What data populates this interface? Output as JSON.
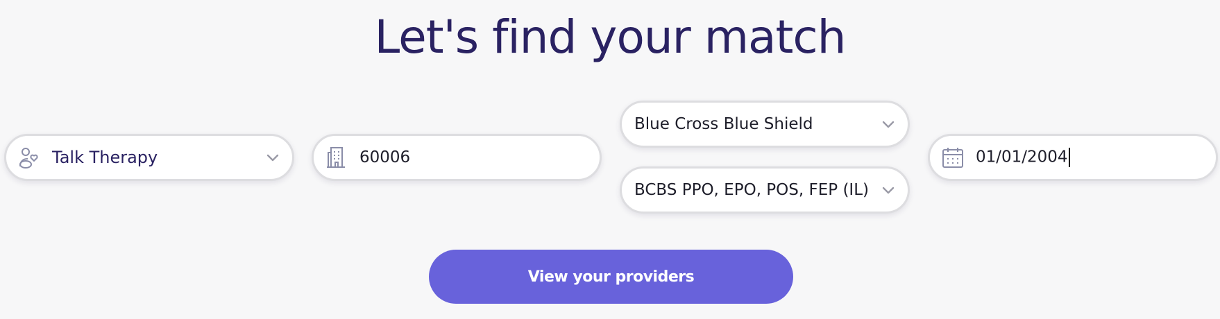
{
  "page": {
    "title": "Let's find your match"
  },
  "colors": {
    "background": "#f7f7f8",
    "title": "#2a2262",
    "accent": "#6862db",
    "field_border": "#dddde0",
    "icon": "#8a8da8"
  },
  "form": {
    "care_type": {
      "value": "Talk Therapy",
      "icon": "people-heart-icon"
    },
    "zip": {
      "value": "60006",
      "icon": "building-icon"
    },
    "insurance_carrier": {
      "value": "Blue Cross Blue Shield"
    },
    "insurance_plan": {
      "value": "BCBS PPO, EPO, POS, FEP (IL)"
    },
    "dob": {
      "value": "01/01/2004",
      "icon": "calendar-icon"
    }
  },
  "cta": {
    "label": "View your providers"
  }
}
